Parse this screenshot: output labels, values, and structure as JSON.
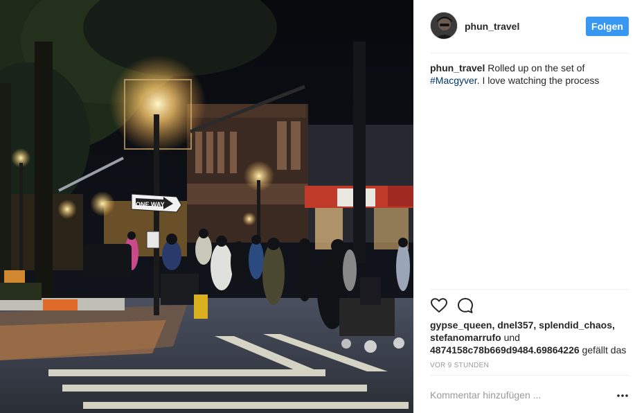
{
  "post": {
    "username": "phun_travel",
    "follow_label": "Folgen",
    "caption_text": "Rolled up on the set of",
    "caption_hashtag": "#Macgyver",
    "caption_tail": ". I love watching the process",
    "likes_names": "gypse_queen, dnel357, splendid_chaos, stefanomarrufo",
    "likes_connector": "und",
    "likes_last": "4874158c78b669d9484.69864226",
    "likes_suffix": "gefällt das",
    "timestamp": "VOR 9 STUNDEN",
    "comment_placeholder": "Kommentar hinzufügen ...",
    "photo_sign": "ONE WAY"
  },
  "icons": {
    "like": "heart-icon",
    "comment": "comment-bubble-icon",
    "more": "more-options-icon"
  },
  "colors": {
    "follow_button": "#3897f0",
    "hashtag": "#003569",
    "muted": "#999999"
  }
}
